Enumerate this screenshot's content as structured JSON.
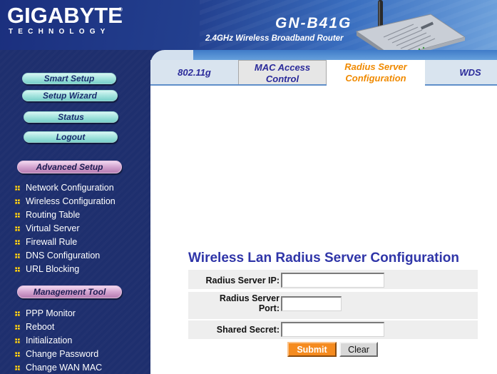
{
  "header": {
    "brand": "GIGABYTE",
    "brand_tm": "®",
    "brand_sub": "TECHNOLOGY",
    "model": "GN-B41G",
    "model_desc": "2.4GHz Wireless Broadband Router",
    "brand_color": "#23408f"
  },
  "sidebar": {
    "buttons": [
      {
        "label": "Smart Setup",
        "icon": "pill-button"
      },
      {
        "label": "Setup Wizard",
        "icon": "pill-button"
      },
      {
        "label": "Status",
        "icon": "pill-button"
      },
      {
        "label": "Logout",
        "icon": "pill-button"
      }
    ],
    "advanced_title": "Advanced Setup",
    "advanced_items": [
      {
        "label": "Network Configuration"
      },
      {
        "label": "Wireless Configuration"
      },
      {
        "label": "Routing Table"
      },
      {
        "label": "Virtual Server"
      },
      {
        "label": "Firewall Rule"
      },
      {
        "label": "DNS Configuration"
      },
      {
        "label": "URL Blocking"
      }
    ],
    "management_title": "Management Tool",
    "management_items": [
      {
        "label": "PPP Monitor"
      },
      {
        "label": "Reboot"
      },
      {
        "label": "Initialization"
      },
      {
        "label": "Change Password"
      },
      {
        "label": "Change WAN MAC"
      }
    ],
    "bullet_icon": "yellow-square-bullet-icon",
    "background_color": "#1e2f6e"
  },
  "tabs": [
    {
      "label": "802.11g",
      "active": false
    },
    {
      "label": "MAC Access Control",
      "line1": "MAC Access",
      "line2": "Control",
      "active": false
    },
    {
      "label": "Radius Server Configuration",
      "line1": "Radius Server",
      "line2": "Configuration",
      "active": true
    },
    {
      "label": "WDS",
      "active": false
    }
  ],
  "main": {
    "title": "Wireless Lan Radius Server Configuration",
    "fields": [
      {
        "label": "Radius Server IP:",
        "value": "",
        "placeholder": ""
      },
      {
        "label_line1": "Radius Server",
        "label_line2": "Port:",
        "value": "",
        "placeholder": ""
      },
      {
        "label": "Shared Secret:",
        "value": "",
        "placeholder": ""
      }
    ],
    "submit_label": "Submit",
    "clear_label": "Clear",
    "title_color": "#2f35a8",
    "active_tab_color": "#f08a00",
    "submit_color": "#f58b1f"
  }
}
